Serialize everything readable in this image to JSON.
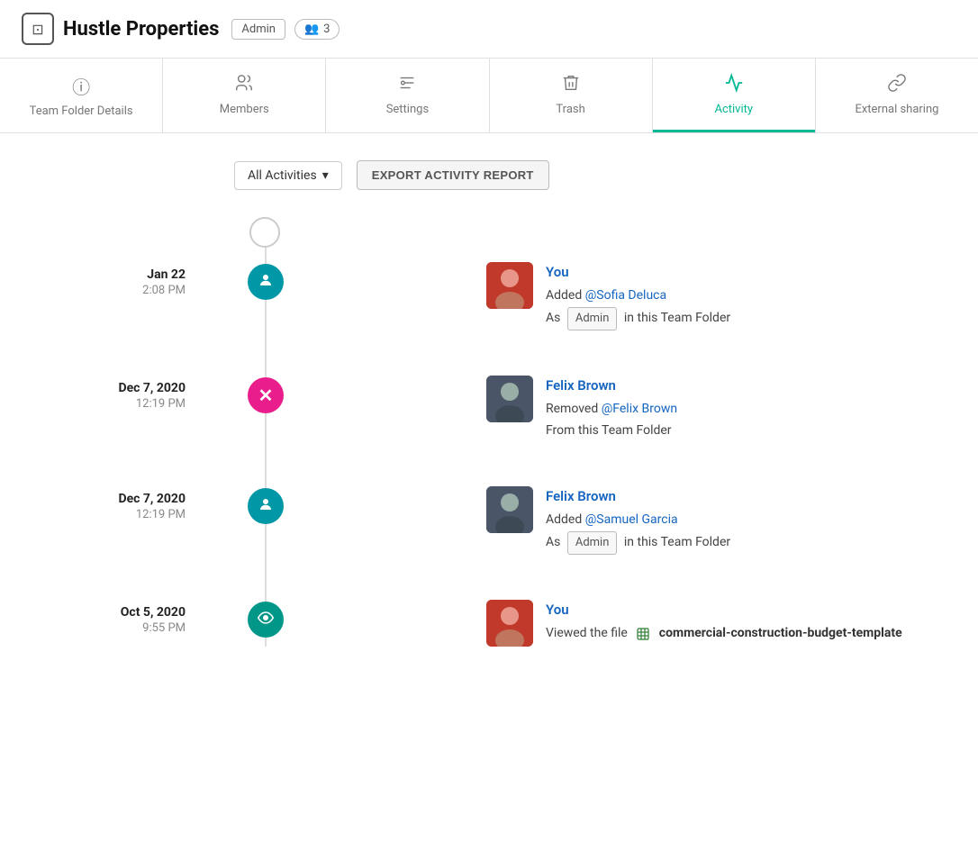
{
  "header": {
    "logo_symbol": "⊡",
    "title": "Hustle Properties",
    "admin_label": "Admin",
    "members_icon": "👥",
    "members_count": "3"
  },
  "tabs": [
    {
      "id": "team-folder-details",
      "label": "Team Folder Details",
      "icon": "ℹ",
      "active": false
    },
    {
      "id": "members",
      "label": "Members",
      "icon": "👤",
      "active": false
    },
    {
      "id": "settings",
      "label": "Settings",
      "icon": "⚙",
      "active": false
    },
    {
      "id": "trash",
      "label": "Trash",
      "icon": "🗑",
      "active": false
    },
    {
      "id": "activity",
      "label": "Activity",
      "icon": "♡",
      "active": true
    },
    {
      "id": "external-sharing",
      "label": "External sharing",
      "icon": "🔗",
      "active": false
    }
  ],
  "controls": {
    "filter_label": "All Activities",
    "filter_icon": "▾",
    "export_label": "EXPORT ACTIVITY REPORT"
  },
  "activities": [
    {
      "id": "act1",
      "date": "Jan 22",
      "time": "2:08 PM",
      "node_type": "blue",
      "actor": "You",
      "action_verb": "Added",
      "mention": "@Sofia Deluca",
      "action_suffix": "As",
      "role": "Admin",
      "role_suffix": "in this Team Folder",
      "avatar_type": "you"
    },
    {
      "id": "act2",
      "date": "Dec 7, 2020",
      "time": "12:19 PM",
      "node_type": "pink",
      "actor": "Felix Brown",
      "action_verb": "Removed",
      "mention": "@Felix Brown",
      "action_suffix": "From this Team Folder",
      "role": null,
      "role_suffix": null,
      "avatar_type": "felix"
    },
    {
      "id": "act3",
      "date": "Dec 7, 2020",
      "time": "12:19 PM",
      "node_type": "blue",
      "actor": "Felix Brown",
      "action_verb": "Added",
      "mention": "@Samuel Garcia",
      "action_suffix": "As",
      "role": "Admin",
      "role_suffix": "in this Team Folder",
      "avatar_type": "felix"
    },
    {
      "id": "act4",
      "date": "Oct 5, 2020",
      "time": "9:55 PM",
      "node_type": "teal",
      "actor": "You",
      "action_verb": "Viewed the file",
      "mention": null,
      "file_name": "commercial-construction-budget-template",
      "action_suffix": null,
      "role": null,
      "role_suffix": null,
      "avatar_type": "you"
    }
  ]
}
